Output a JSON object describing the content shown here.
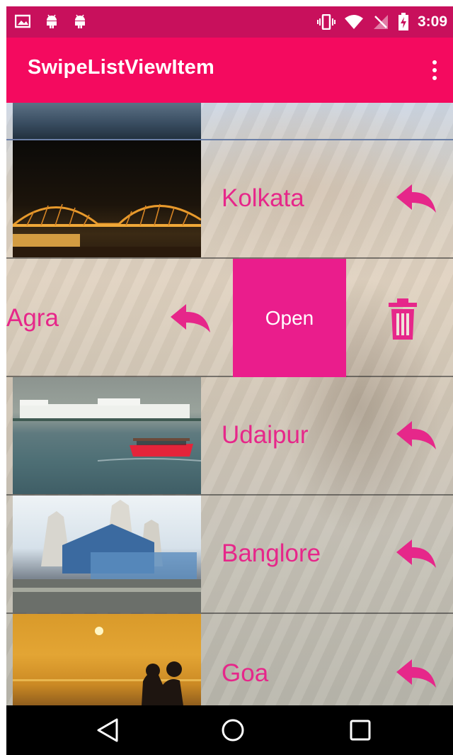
{
  "status_bar": {
    "time": "3:09",
    "icons_left": [
      "image-icon",
      "android-icon",
      "android-icon"
    ],
    "icons_right": [
      "vibrate-icon",
      "wifi-icon",
      "no-sim-icon",
      "battery-charging-icon"
    ],
    "color": "#c8105c"
  },
  "app_bar": {
    "title": "SwipeListViewItem",
    "color": "#f40a5f",
    "overflow_icon": "more-vert-icon"
  },
  "list": {
    "accent": "#e6278a",
    "items": [
      {
        "label": "Kolkata",
        "action_icon": "undo-icon"
      },
      {
        "label": "Agra",
        "action_icon": "undo-icon",
        "swipe_open": true,
        "open_label": "Open",
        "delete_icon": "trash-icon"
      },
      {
        "label": "Udaipur",
        "action_icon": "undo-icon"
      },
      {
        "label": "Banglore",
        "action_icon": "undo-icon"
      },
      {
        "label": "Goa",
        "action_icon": "undo-icon"
      }
    ]
  },
  "nav_bar": {
    "buttons": [
      "back-icon",
      "home-icon",
      "recents-icon"
    ]
  }
}
